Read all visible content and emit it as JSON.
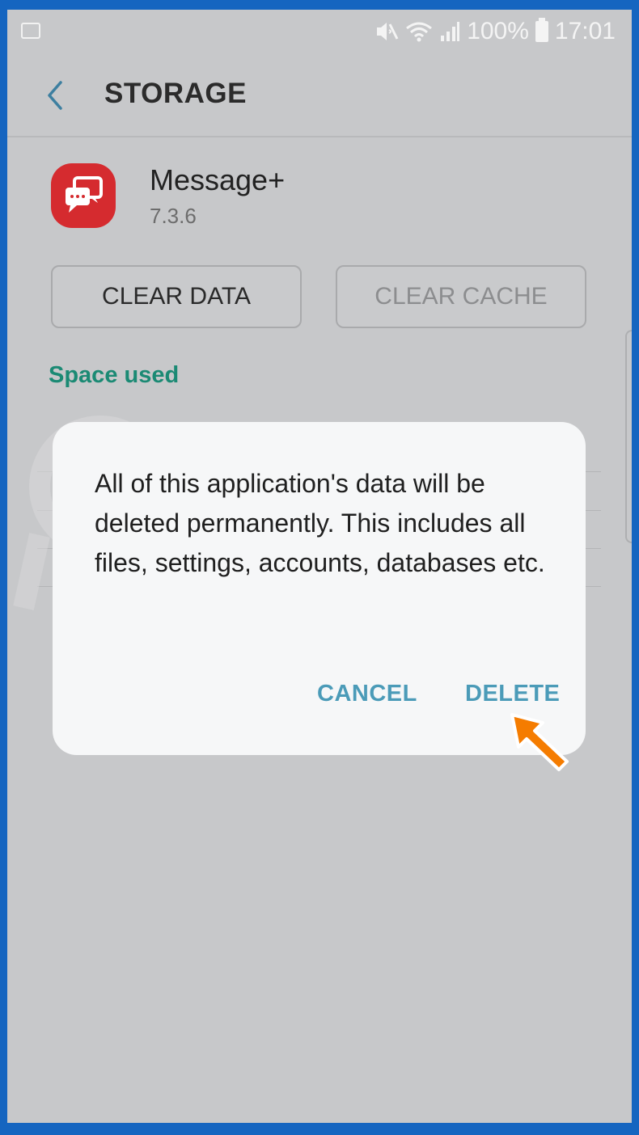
{
  "status_bar": {
    "battery": "100%",
    "time": "17:01"
  },
  "header": {
    "title": "STORAGE"
  },
  "app": {
    "name": "Message+",
    "version": "7.3.6",
    "icon_color": "#d52b2f"
  },
  "actions": {
    "clear_data": "CLEAR DATA",
    "clear_cache": "CLEAR CACHE"
  },
  "space_used": {
    "title": "Space used"
  },
  "dialog": {
    "message": "All of this application's data will be deleted permanently. This includes all files, settings, accounts, databases etc.",
    "cancel": "CANCEL",
    "delete": "DELETE",
    "button_color": "#4b9bb8"
  },
  "colors": {
    "frame": "#1565c0",
    "accent": "#1b8a74",
    "pointer": "#f57c00"
  }
}
